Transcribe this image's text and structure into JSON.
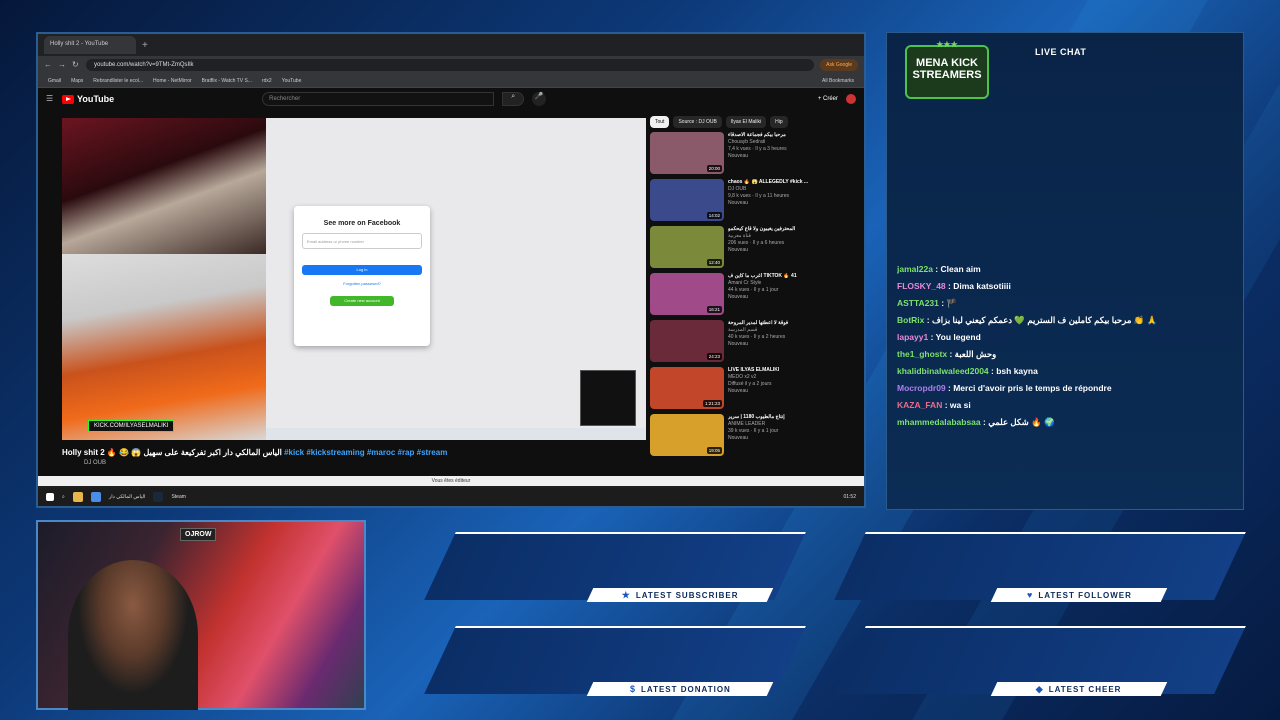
{
  "browser": {
    "tab_title": "Holly shit 2 - YouTube",
    "url": "youtube.com/watch?v=9TMt-ZmQsIlk",
    "ask_google": "Ask Google",
    "bookmarks": [
      "Gmail",
      "Maps",
      "Rebrandlister le ecol...",
      "Home - NetMirror",
      "Bratflix - Watch TV S...",
      "rdx2",
      "YouTube"
    ],
    "all_bookmarks": "All Bookmarks"
  },
  "youtube": {
    "logo": "YouTube",
    "search_placeholder": "Rechercher",
    "create_label": "Créer",
    "video_title": "Holly shit 2 🔥 😂 😱",
    "video_title_ar": "الياس المالكي دار اكبر تفركيعة على سهيل",
    "hashtags": "#kick #kickstreaming #maroc #rap #stream",
    "channel": "DJ OUB",
    "chips": [
      "Tout",
      "Source : DJ OUB",
      "Ilyas El Maliki",
      "Hip"
    ],
    "recommendations": [
      {
        "title": "مرحبا بيكم فجماعة الاصدقاء",
        "channel": "Chouayb Sedrati",
        "meta": "7,4 k vues · Il y a 3 heures",
        "badge": "Nouveau",
        "duration": "20:00",
        "color": "#8a5a6a"
      },
      {
        "title": "chaos 🔥 😱 ALLEGEDLY #kick ...",
        "channel": "DJ OUB",
        "meta": "9,8 k vues · Il y a 11 heures",
        "badge": "Nouveau",
        "duration": "14:02",
        "color": "#3a4a8a"
      },
      {
        "title": "المحترفين يغيبون ولا قاع كيحكمو",
        "channel": "قناة مغربية",
        "meta": "206 vues · Il y a 6 heures",
        "badge": "Nouveau",
        "duration": "12:40",
        "color": "#7a8a3a"
      },
      {
        "title": "أغرب ما كاين ف TIKTOK 🔥 41",
        "channel": "Amani Cr Style",
        "meta": "44 k vues · Il y a 1 jour",
        "badge": "Nouveau",
        "duration": "16:21",
        "color": "#a04a8a"
      },
      {
        "title": "فوقة لا اعطتها لمدير المروحة",
        "channel": "قسم المدرسة",
        "meta": "40 k vues · Il y a 2 heures",
        "badge": "Nouveau",
        "duration": "24:23",
        "color": "#6a2a3a"
      },
      {
        "title": "LIVE ILYAS ELMALIKI",
        "channel": "MEDO x2 v2",
        "meta": "Diffusé il y a 2 jours",
        "badge": "Nouveau",
        "duration": "1:21:23",
        "color": "#c2462a"
      },
      {
        "title": "إنتاج مالطيوب 1180 | سرير",
        "channel": "ANIME LEADER",
        "meta": "39 k vues · Il y a 1 jour",
        "badge": "Nouveau",
        "duration": "19:05",
        "color": "#d6a02a"
      }
    ],
    "edit_notice": "Vous êtes éditeur"
  },
  "facebook_modal": {
    "title": "See more on Facebook",
    "input_placeholder": "Email address or phone number",
    "password_placeholder": "Password",
    "login": "Log in",
    "forgot": "Forgotten password?",
    "create": "Create new account"
  },
  "stream": {
    "kick_tag": "KICK.COM/ILYASELMALIKI",
    "webcam_sign": "OJROW"
  },
  "taskbar": {
    "items": [
      "Search",
      "Files",
      "Chrome",
      "Steam"
    ],
    "chrome_label": "الياس المالكي دار",
    "steam_label": "Steam",
    "time": "01:52"
  },
  "chat": {
    "logo_line1": "MENA KICK",
    "logo_line2": "STREAMERS",
    "title": "LIVE CHAT",
    "messages": [
      {
        "user": "jamal22a",
        "text": "Clean aim",
        "color": "#7ee06b"
      },
      {
        "user": "FLOSKY_48",
        "text": "Dima katsotiiii",
        "color": "#e48ad8"
      },
      {
        "user": "ASTTA231",
        "text": "🏴",
        "color": "#7ee06b"
      },
      {
        "user": "BotRix",
        "text": "مرحبا بيكم كاملين ف الستريم 💚 دعمكم كيعني لينا بزاف 👏 🙏",
        "color": "#7ee06b"
      },
      {
        "user": "lapayy1",
        "text": "You legend",
        "color": "#e48ad8"
      },
      {
        "user": "the1_ghostx",
        "text": "وحش اللعبة",
        "color": "#7ee06b"
      },
      {
        "user": "khalidbinalwaleed2004",
        "text": "bsh kayna",
        "color": "#7ee06b"
      },
      {
        "user": "Mocropdr09",
        "text": "Merci d'avoir pris le temps de répondre",
        "color": "#b07cf0"
      },
      {
        "user": "KAZA_FAN",
        "text": "wa si",
        "color": "#f06a8a"
      },
      {
        "user": "mhammedalababsaa",
        "text": "شكل علمي 🔥 🌍",
        "color": "#7ee06b"
      }
    ]
  },
  "alerts": {
    "latest_subscriber": "LATEST SUBSCRIBER",
    "latest_follower": "LATEST FOLLOWER",
    "latest_donation": "LATEST DONATION",
    "latest_cheer": "LATEST CHEER"
  }
}
